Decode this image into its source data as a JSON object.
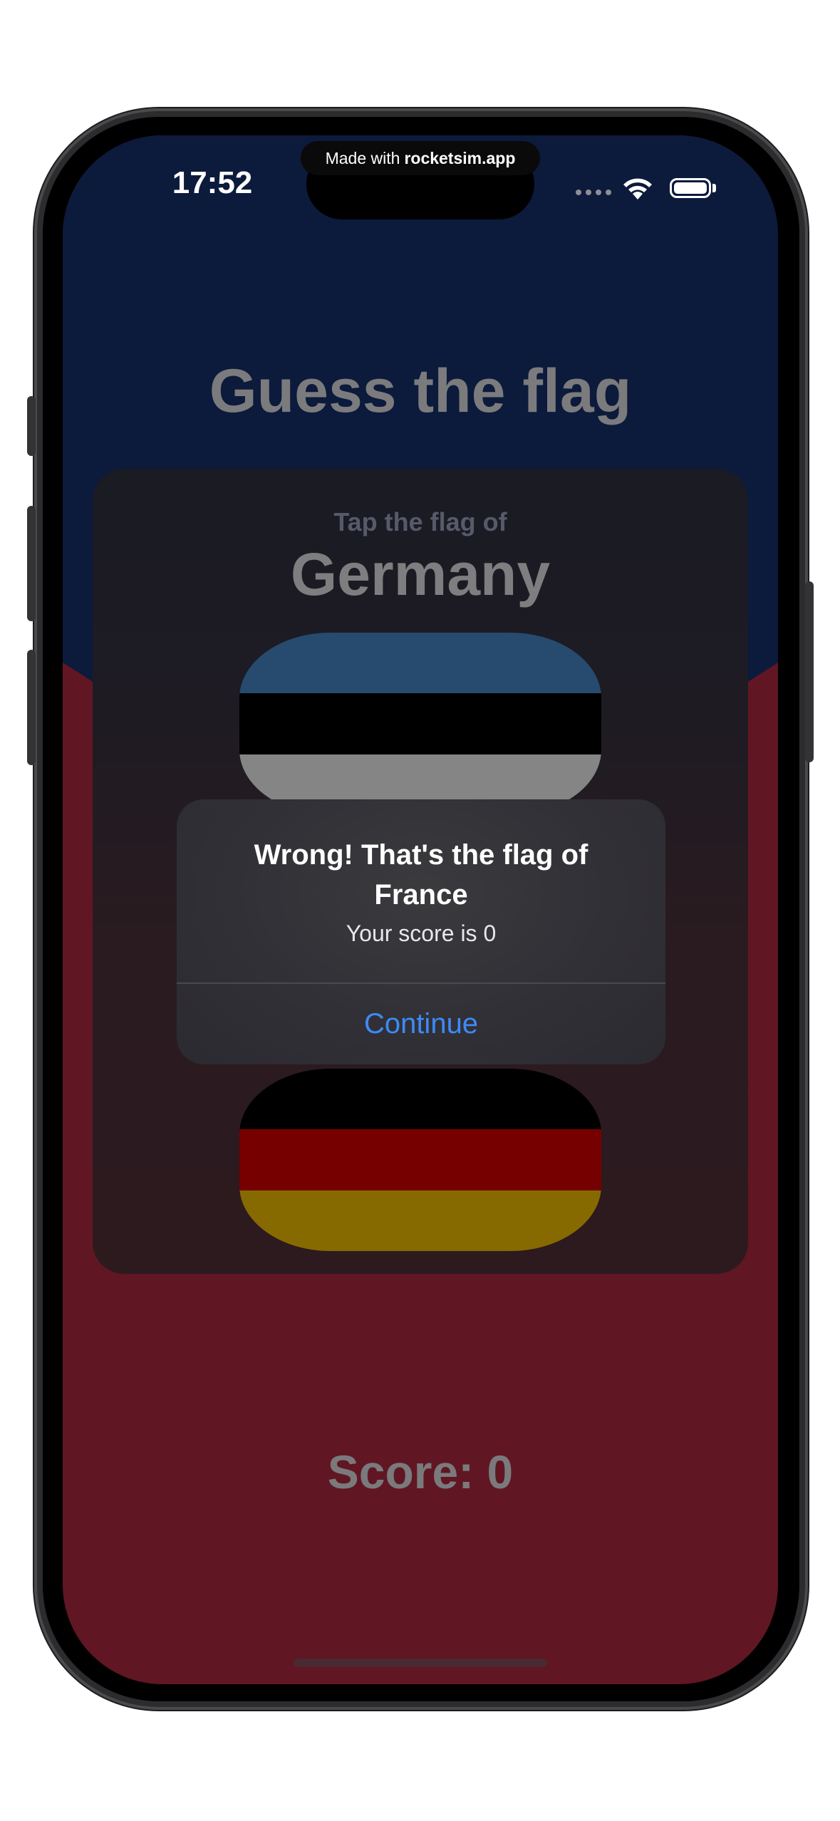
{
  "status_bar": {
    "time": "17:52",
    "recorder_prefix": "Made with",
    "recorder_brand": "rocketsim.app"
  },
  "game": {
    "title": "Guess the flag",
    "prompt": "Tap the flag of",
    "country": "Germany",
    "score_label": "Score: 0",
    "flags": [
      {
        "name": "estonia-flag",
        "stripes": [
          "#264b6e",
          "#000000",
          "#858585"
        ]
      },
      {
        "name": "germany-flag",
        "stripes": [
          "#000000",
          "#760000",
          "#866a00"
        ]
      }
    ]
  },
  "colors": {
    "background_top": "#0c1a3c",
    "background_bottom": "#611624",
    "accent": "#3d8af7"
  },
  "alert": {
    "title": "Wrong! That's the flag of France",
    "message": "Your score is 0",
    "button_label": "Continue"
  }
}
